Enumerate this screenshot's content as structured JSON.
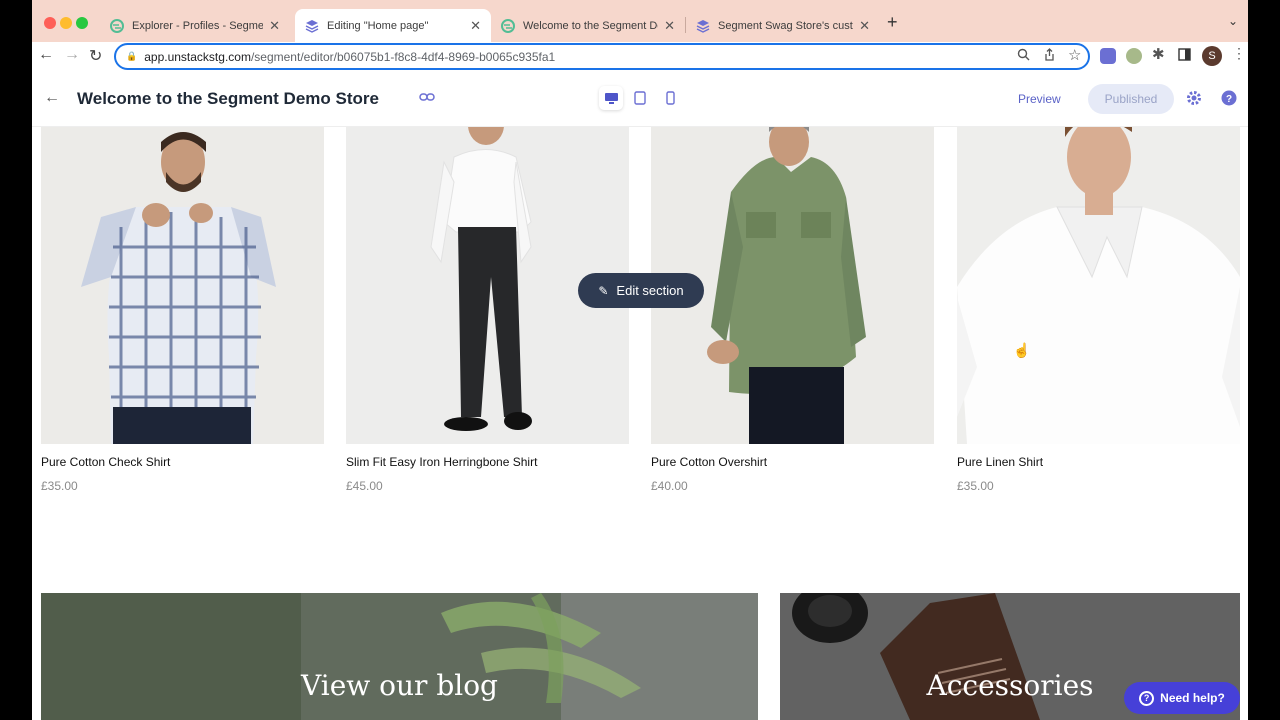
{
  "browser": {
    "tabs": [
      {
        "title": "Explorer - Profiles - Segment",
        "active": false
      },
      {
        "title": "Editing \"Home page\"",
        "active": true
      },
      {
        "title": "Welcome to the Segment Demo Store",
        "active": false
      },
      {
        "title": "Segment Swag Store's custom",
        "active": false
      }
    ],
    "new_tab": "+",
    "url_host": "app.unstackstg.com",
    "url_path": "/segment/editor/b06075b1-f8c8-4df4-8969-b0065c935fa1",
    "profile_initial": "S"
  },
  "editor": {
    "title": "Welcome to the Segment Demo Store",
    "preview_label": "Preview",
    "published_label": "Published",
    "edit_section_label": "Edit section"
  },
  "products": [
    {
      "name": "Pure Cotton Check Shirt",
      "price": "£35.00"
    },
    {
      "name": "Slim Fit Easy Iron Herringbone Shirt",
      "price": "£45.00"
    },
    {
      "name": "Pure Cotton Overshirt",
      "price": "£40.00"
    },
    {
      "name": "Pure Linen Shirt",
      "price": "£35.00"
    }
  ],
  "banners": [
    {
      "title": "View our blog"
    },
    {
      "title": "Accessories"
    }
  ],
  "help": {
    "label": "Need help?"
  },
  "colors": {
    "tabstrip": "#f6d7cc",
    "accent": "#1a73e8",
    "edit_button": "#2f3b52",
    "help_button": "#4640d8"
  }
}
